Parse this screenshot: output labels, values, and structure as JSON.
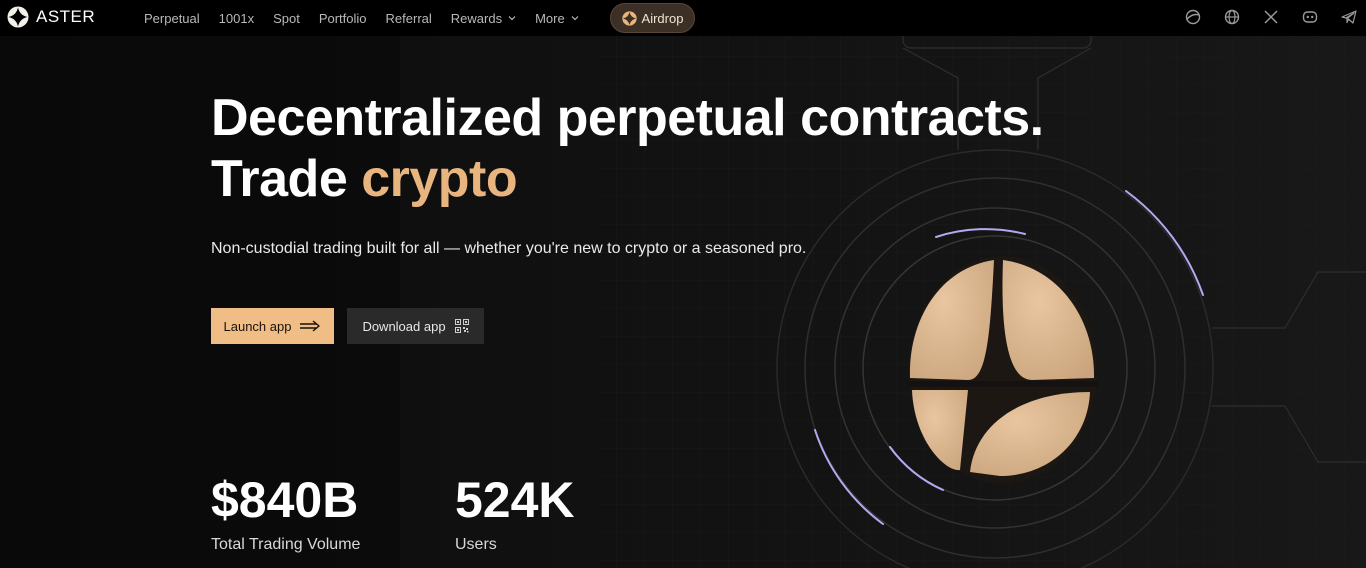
{
  "header": {
    "brand": "ASTER",
    "nav": [
      {
        "label": "Perpetual"
      },
      {
        "label": "1001x"
      },
      {
        "label": "Spot"
      },
      {
        "label": "Portfolio"
      },
      {
        "label": "Referral"
      },
      {
        "label": "Rewards",
        "dropdown": true
      },
      {
        "label": "More",
        "dropdown": true
      }
    ],
    "airdrop_label": "Airdrop",
    "social_icons": [
      "theme-toggle-icon",
      "globe-icon",
      "x-icon",
      "discord-icon",
      "telegram-icon"
    ]
  },
  "hero": {
    "title_line1": "Decentralized perpetual contracts.",
    "title_line2_prefix": "Trade ",
    "title_line2_accent": "crypto",
    "subtitle": "Non-custodial trading built for all — whether you're new to crypto or a seasoned pro.",
    "launch_label": "Launch app",
    "download_label": "Download app"
  },
  "stats": [
    {
      "value": "$840B",
      "label": "Total Trading Volume"
    },
    {
      "value": "524K",
      "label": "Users"
    }
  ],
  "colors": {
    "accent": "#e9b57f",
    "button_primary": "#efbd85",
    "background": "#0f0f0f",
    "ring_glow": "#b9a6f2"
  }
}
